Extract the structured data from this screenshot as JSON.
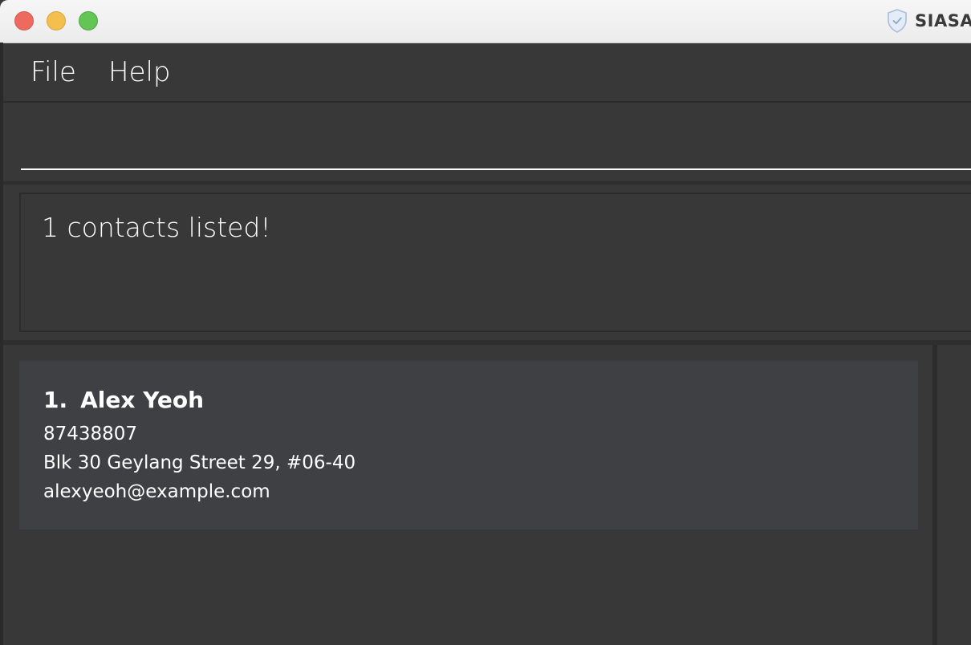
{
  "window": {
    "title": "SIASA",
    "title_icon": "shield-check-icon",
    "controls": [
      "close",
      "minimize",
      "zoom"
    ]
  },
  "menu": {
    "file_label": "File",
    "help_label": "Help"
  },
  "command": {
    "value": "",
    "placeholder": ""
  },
  "result": {
    "message": "1 contacts listed!"
  },
  "contacts": [
    {
      "index": "1.",
      "name": "Alex Yeoh",
      "phone": "87438807",
      "address": "Blk 30 Geylang Street 29, #06-40",
      "email": "alexyeoh@example.com"
    }
  ],
  "colors": {
    "background": "#383838",
    "card": "#3f4043",
    "text": "#ffffff",
    "close": "#ed6a5e",
    "minimize": "#f5bf4f",
    "zoom": "#62c554"
  }
}
